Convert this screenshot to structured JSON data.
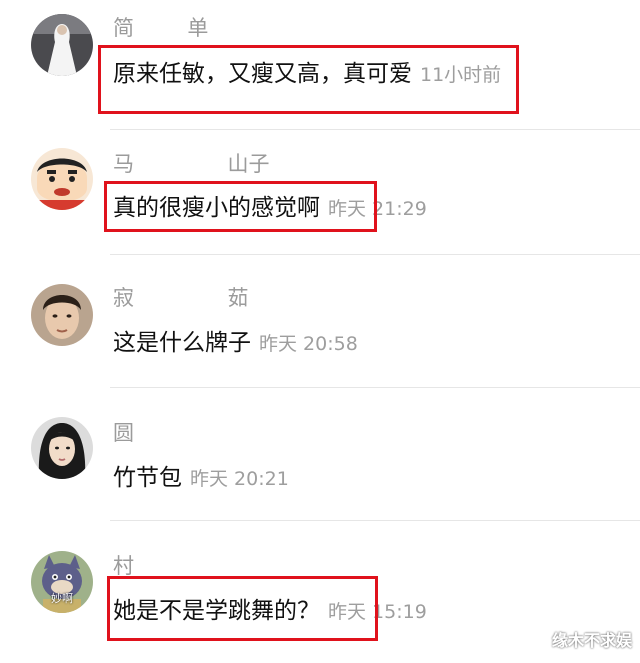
{
  "comments": [
    {
      "username": "简        单",
      "text": "原来任敏，又瘦又高，真可爱",
      "time": "11小时前",
      "avatar": "bride-photo"
    },
    {
      "username": "马              山子",
      "text": "真的很瘦小的感觉啊",
      "time": "昨天 21:29",
      "avatar": "cartoon-boy"
    },
    {
      "username": "寂              茹",
      "text": "这是什么牌子",
      "time": "昨天 20:58",
      "avatar": "man-photo"
    },
    {
      "username": "圆       ",
      "text": "竹节包",
      "time": "昨天 20:21",
      "avatar": "woman-photo"
    },
    {
      "username": "村",
      "text": "她是不是学跳舞的？",
      "time": "昨天 15:19",
      "avatar": "cartoon-cat",
      "avatar_label": "妙啊"
    }
  ],
  "watermark": "缘木不求娱",
  "colors": {
    "highlight": "#e0121c",
    "username": "#9b9b9b",
    "time": "#9e9e9e",
    "separator": "#e6e6e6"
  }
}
